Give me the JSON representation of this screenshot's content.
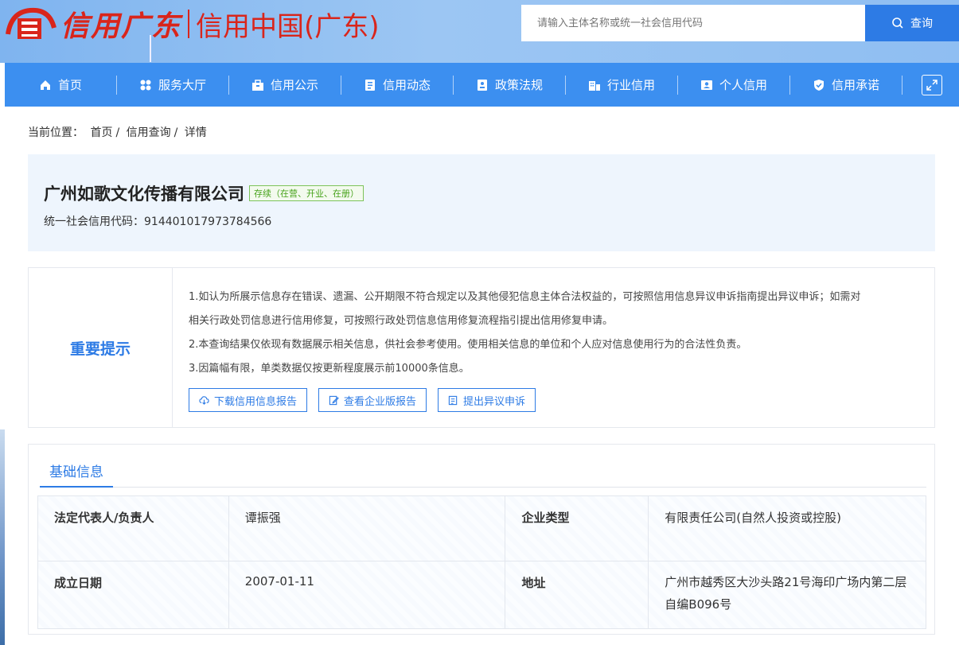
{
  "header": {
    "logo_script": "信用广东",
    "logo_text": "信用中国(广东)",
    "search_placeholder": "请输入主体名称或统一社会信用代码",
    "search_button": "查询"
  },
  "nav": {
    "items": [
      {
        "label": "首页",
        "icon": "home-icon"
      },
      {
        "label": "服务大厅",
        "icon": "grid-icon"
      },
      {
        "label": "信用公示",
        "icon": "briefcase-icon"
      },
      {
        "label": "信用动态",
        "icon": "document-icon"
      },
      {
        "label": "政策法规",
        "icon": "book-icon"
      },
      {
        "label": "行业信用",
        "icon": "building-icon"
      },
      {
        "label": "个人信用",
        "icon": "person-card-icon"
      },
      {
        "label": "信用承诺",
        "icon": "shield-icon"
      }
    ]
  },
  "breadcrumb": {
    "prefix": "当前位置：",
    "items": [
      "首页",
      "信用查询",
      "详情"
    ],
    "sep": "/"
  },
  "company": {
    "name": "广州如歌文化传播有限公司",
    "status": "存续（在营、开业、在册）",
    "credit_label": "统一社会信用代码：",
    "credit_code": "914401017973784566"
  },
  "notice": {
    "title": "重要提示",
    "lines": [
      "1.如认为所展示信息存在错误、遗漏、公开期限不符合规定以及其他侵犯信息主体合法权益的，可按照信用信息异议申诉指南提出异议申诉；如需对",
      "相关行政处罚信息进行信用修复，可按照行政处罚信息信用修复流程指引提出信用修复申请。",
      "2.本查询结果仅依现有数据展示相关信息，供社会参考使用。使用相关信息的单位和个人应对信息使用行为的合法性负责。",
      "3.因篇幅有限，单类数据仅按更新程度展示前10000条信息。"
    ],
    "buttons": [
      {
        "label": "下载信用信息报告",
        "icon": "cloud-download-icon"
      },
      {
        "label": "查看企业版报告",
        "icon": "edit-document-icon"
      },
      {
        "label": "提出异议申诉",
        "icon": "form-icon"
      }
    ]
  },
  "basic": {
    "tab": "基础信息",
    "rows": [
      {
        "l1": "法定代表人/负责人",
        "v1": "谭振强",
        "l2": "企业类型",
        "v2": "有限责任公司(自然人投资或控股)"
      },
      {
        "l1": "成立日期",
        "v1": "2007-01-11",
        "l2": "地址",
        "v2": "广州市越秀区大沙头路21号海印广场内第二层自编B096号"
      }
    ]
  },
  "colors": {
    "primary": "#2d7be5",
    "nav": "#3c8ff0",
    "brand_red": "#d9251b",
    "status_green": "#46a21a"
  }
}
